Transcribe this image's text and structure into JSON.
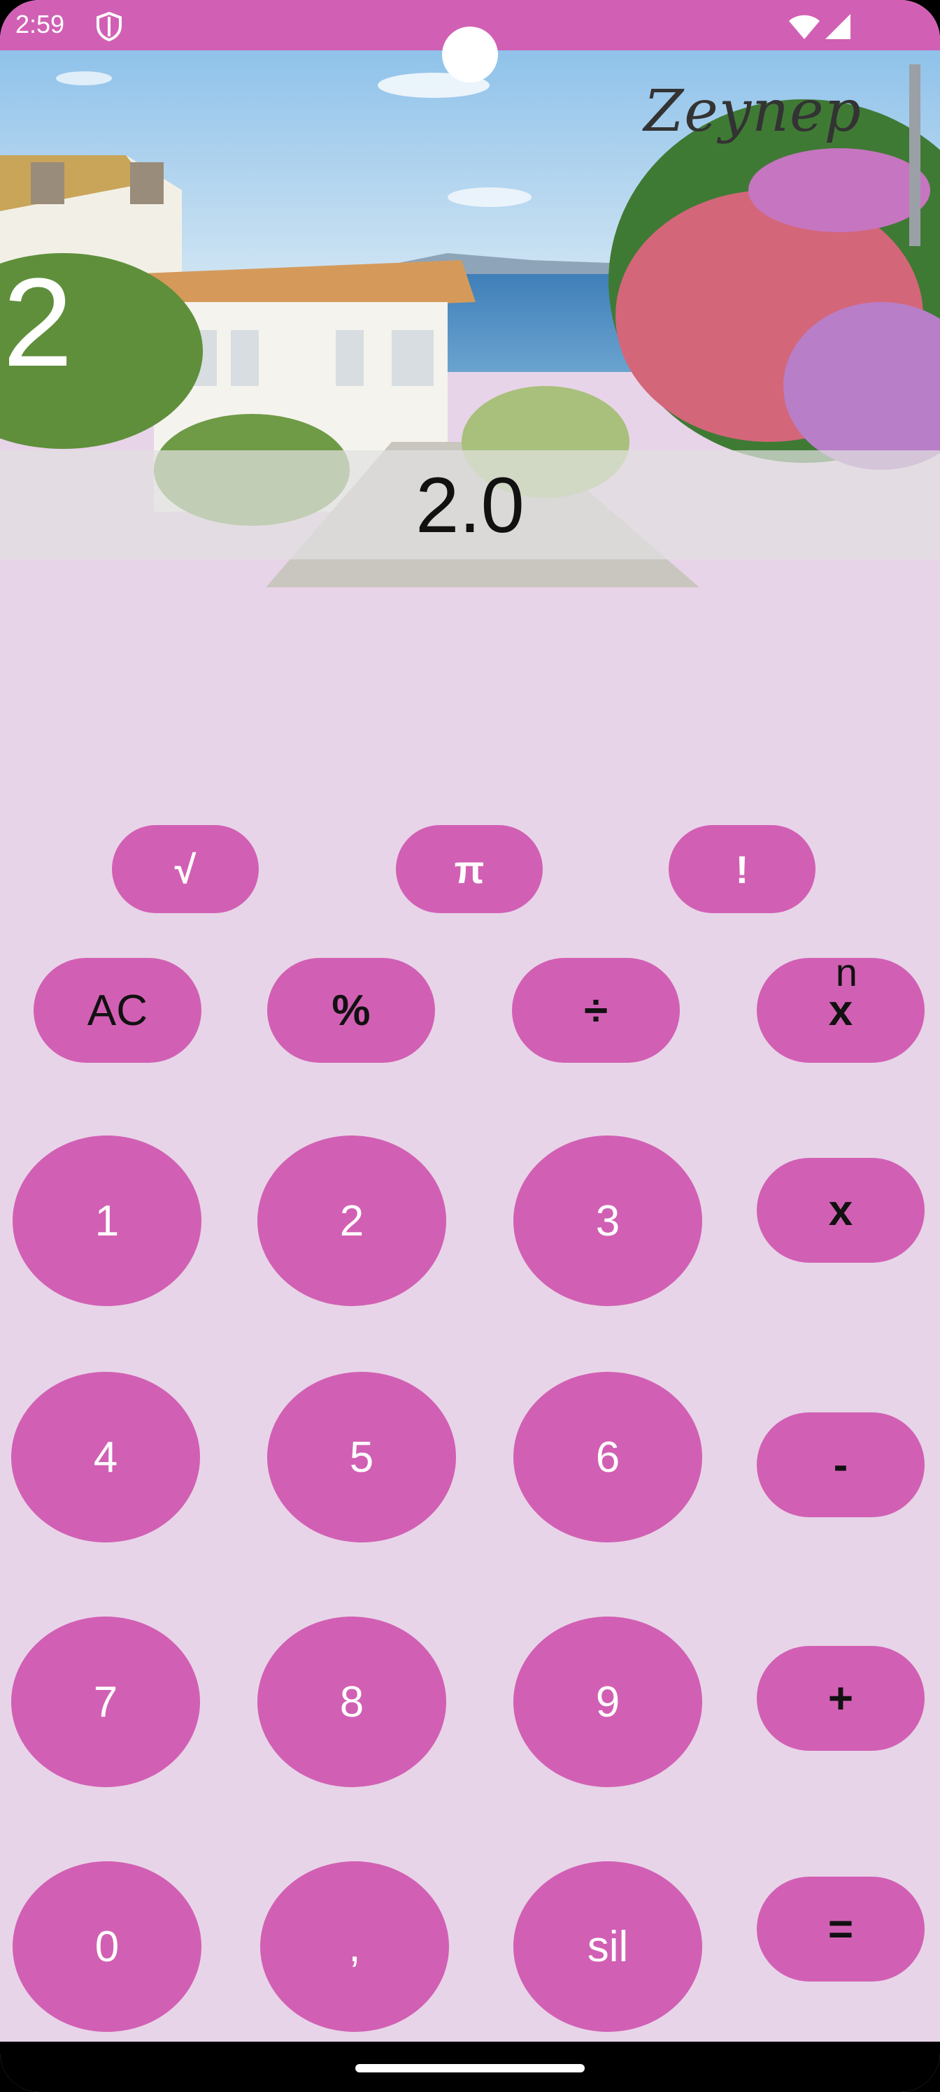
{
  "status_bar": {
    "time": "2:59",
    "icons": [
      "shield-icon",
      "wifi-icon",
      "signal-icon"
    ]
  },
  "header": {
    "brand_logo": "Zeynep"
  },
  "display": {
    "expression": "2",
    "result": "2.0"
  },
  "buttons": {
    "sqrt": "√",
    "pi": "π",
    "factorial": "!",
    "ac": "AC",
    "percent": "%",
    "divide": "÷",
    "power_base": "x",
    "power_exp": "n",
    "multiply": "x",
    "minus": "-",
    "plus": "+",
    "equals": "=",
    "d1": "1",
    "d2": "2",
    "d3": "3",
    "d4": "4",
    "d5": "5",
    "d6": "6",
    "d7": "7",
    "d8": "8",
    "d9": "9",
    "d0": "0",
    "comma": ",",
    "delete": "sil"
  },
  "colors": {
    "accent": "#d160b4",
    "background": "#e8d4e8",
    "status_bar": "#d160b4"
  }
}
